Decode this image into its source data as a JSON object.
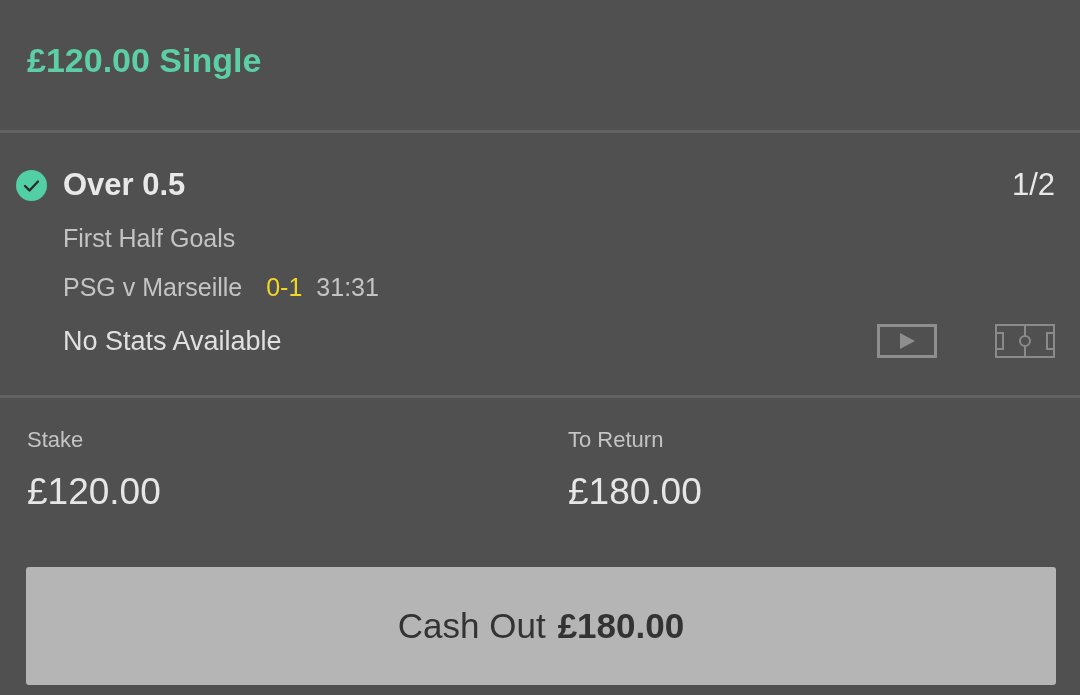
{
  "header": {
    "title": "£120.00 Single"
  },
  "selection": {
    "won": true,
    "name": "Over 0.5",
    "odds": "1/2",
    "market": "First Half Goals",
    "match": "PSG v Marseille",
    "score": "0-1",
    "clock": "31:31",
    "stats": "No Stats Available"
  },
  "summary": [
    {
      "label": "Stake",
      "value": "£120.00"
    },
    {
      "label": "To Return",
      "value": "£180.00"
    }
  ],
  "cash_out": {
    "label": "Cash Out",
    "amount": "£180.00"
  }
}
